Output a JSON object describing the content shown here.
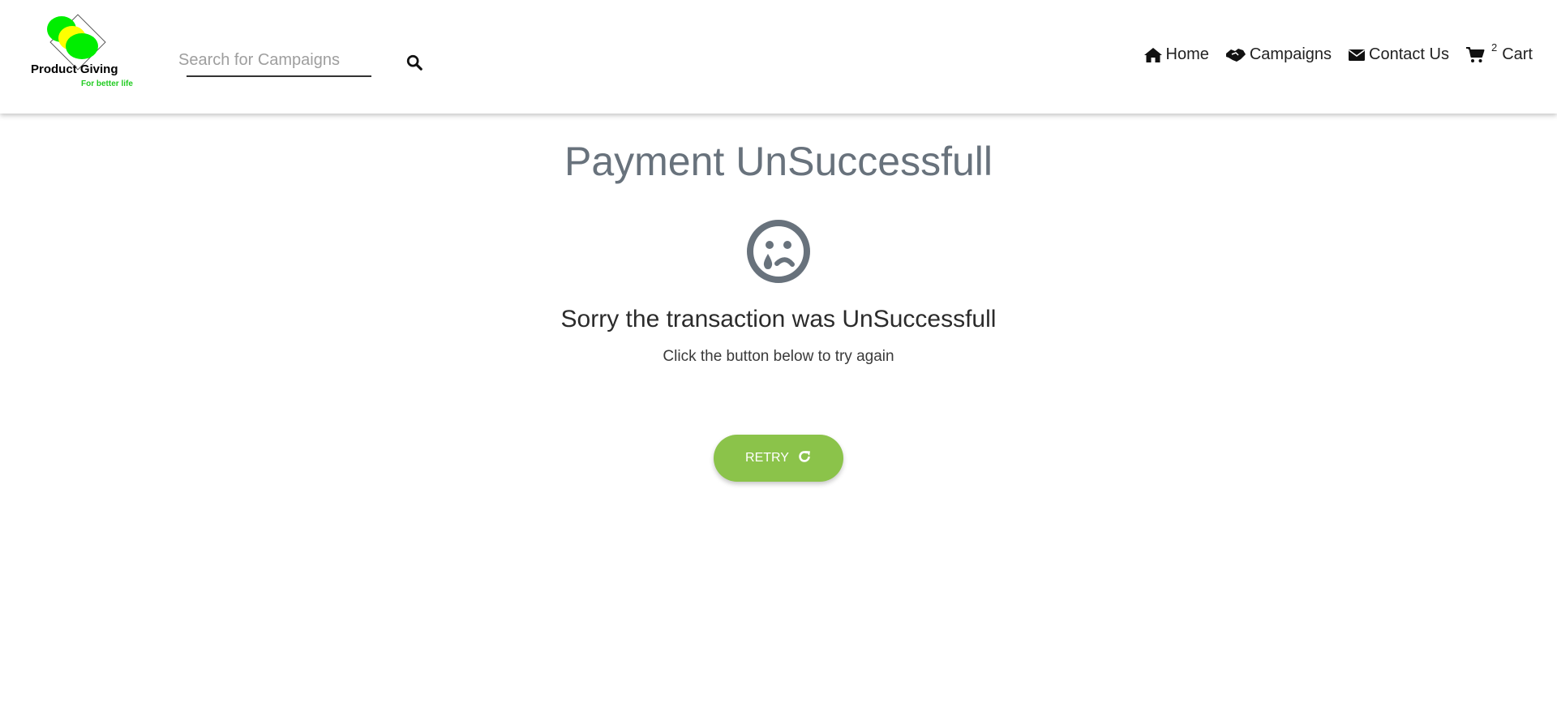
{
  "header": {
    "logo": {
      "brand_text": "Product Giving",
      "tagline": "For better life",
      "colors": {
        "green": "#00ee00",
        "yellow": "#ffff00"
      }
    },
    "search": {
      "placeholder": "Search for Campaigns",
      "value": "",
      "icon": "search-icon"
    },
    "nav": {
      "home": {
        "label": "Home",
        "icon": "home-icon"
      },
      "campaigns": {
        "label": "Campaigns",
        "icon": "handshake-icon"
      },
      "contact": {
        "label": "Contact Us",
        "icon": "envelope-icon"
      },
      "cart": {
        "label": "Cart",
        "count": "2",
        "icon": "cart-icon"
      }
    }
  },
  "main": {
    "title": "Payment UnSuccessfull",
    "status_icon": "sad-tear-icon",
    "message": "Sorry the transaction was UnSuccessfull",
    "hint": "Click the button below to try again",
    "retry": {
      "label": "RETRY",
      "icon": "redo-icon"
    }
  },
  "colors": {
    "title": "#68727c",
    "retry_button": "#8bc34a",
    "icon": "#68727c"
  }
}
